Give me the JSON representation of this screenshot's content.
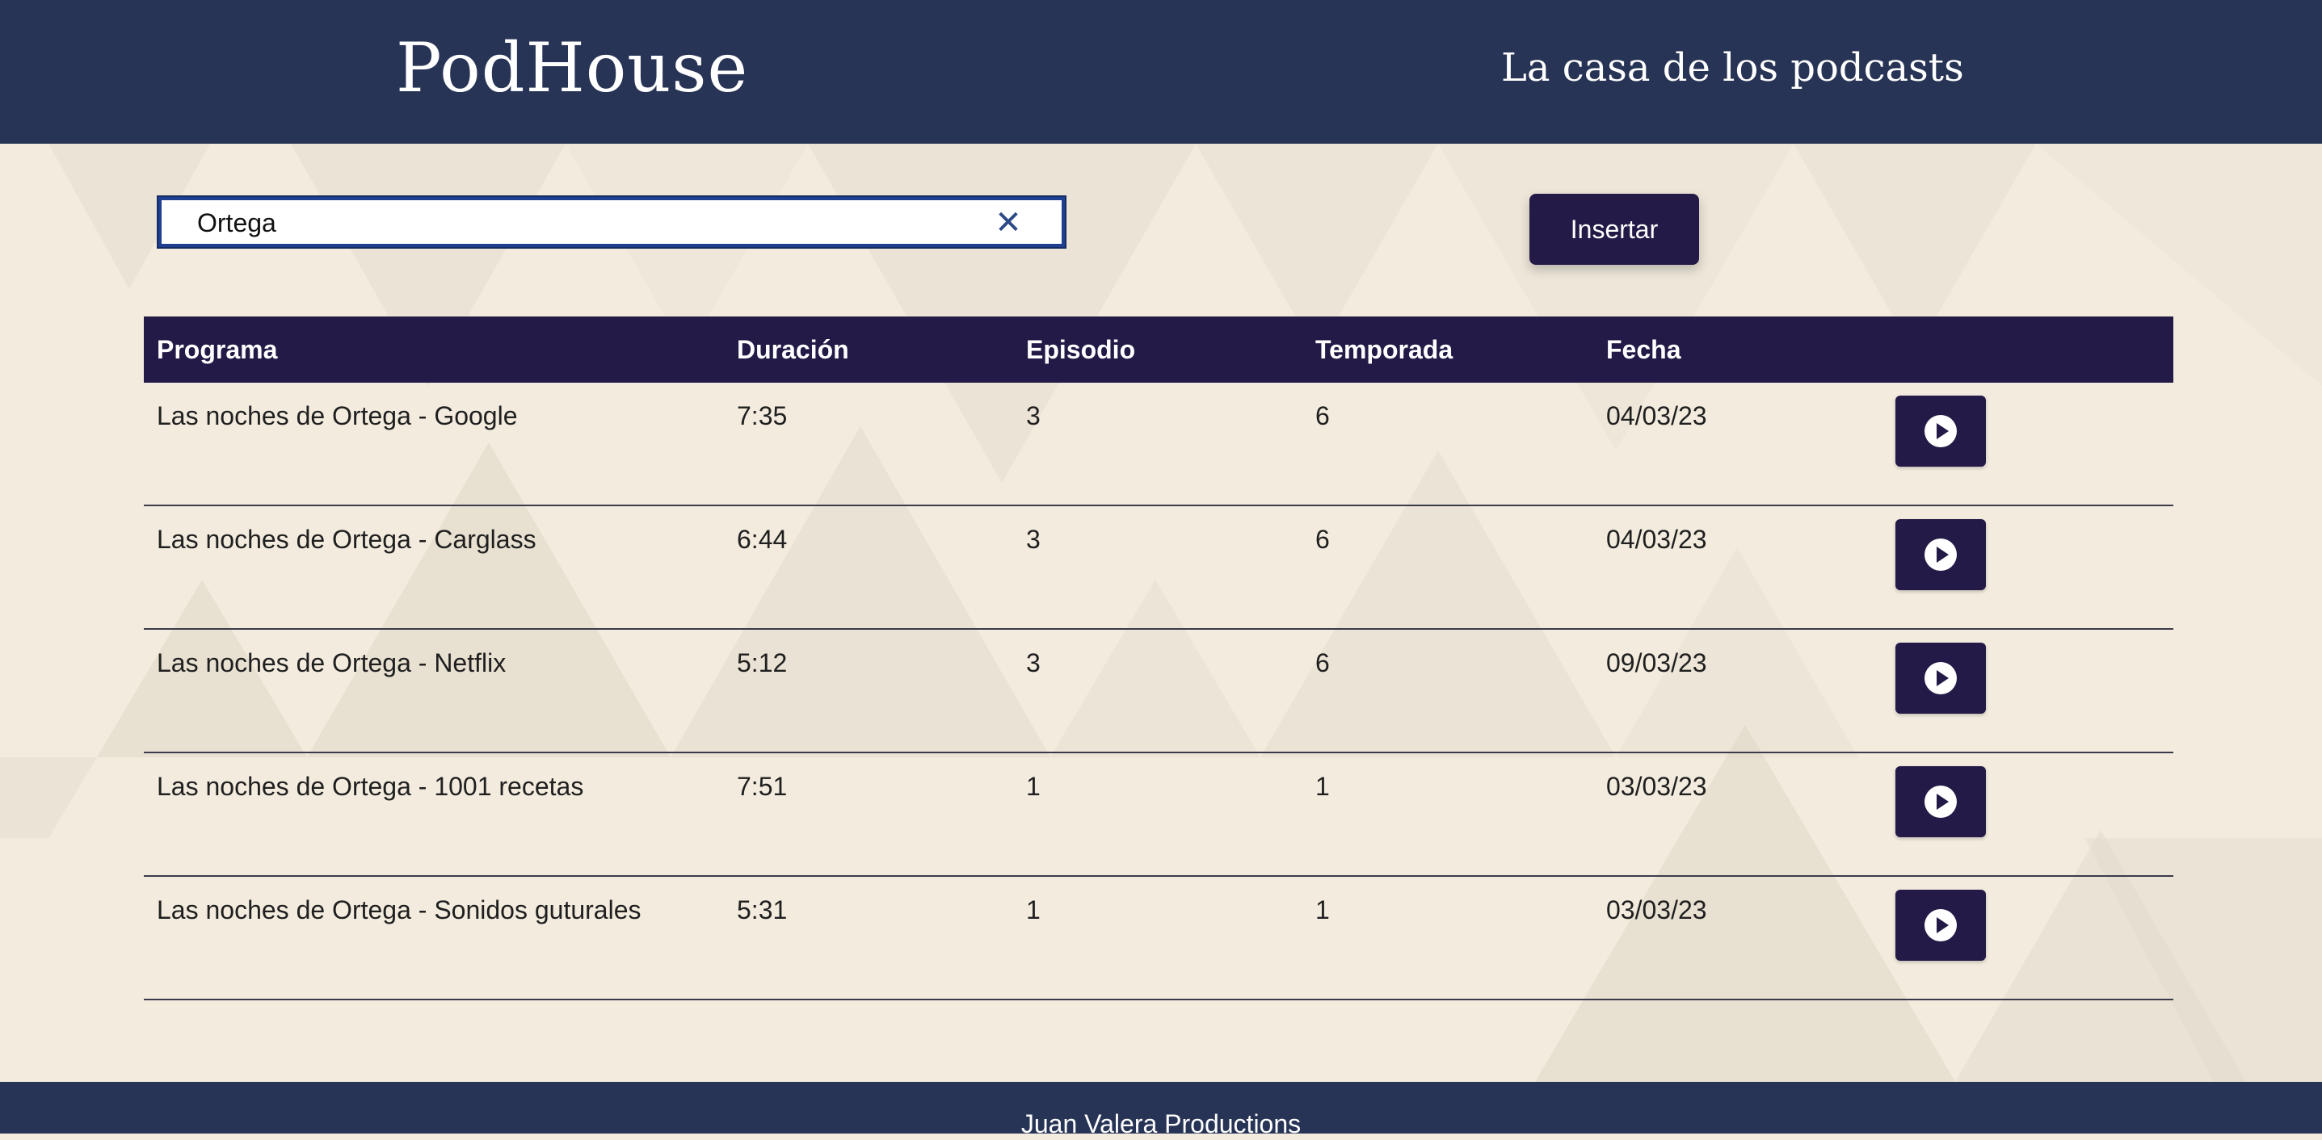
{
  "header": {
    "brand": "PodHouse",
    "tagline": "La casa de los podcasts"
  },
  "search": {
    "value": "Ortega",
    "clear_icon": "close-icon"
  },
  "actions": {
    "insert_label": "Insertar"
  },
  "table": {
    "columns": [
      "Programa",
      "Duración",
      "Episodio",
      "Temporada",
      "Fecha"
    ],
    "rows": [
      {
        "programa": "Las noches de Ortega - Google",
        "duracion": "7:35",
        "episodio": "3",
        "temporada": "6",
        "fecha": "04/03/23"
      },
      {
        "programa": "Las noches de Ortega - Carglass",
        "duracion": "6:44",
        "episodio": "3",
        "temporada": "6",
        "fecha": "04/03/23"
      },
      {
        "programa": "Las noches de Ortega - Netflix",
        "duracion": "5:12",
        "episodio": "3",
        "temporada": "6",
        "fecha": "09/03/23"
      },
      {
        "programa": "Las noches de Ortega - 1001 recetas",
        "duracion": "7:51",
        "episodio": "1",
        "temporada": "1",
        "fecha": "03/03/23"
      },
      {
        "programa": "Las noches de Ortega - Sonidos guturales",
        "duracion": "5:31",
        "episodio": "1",
        "temporada": "1",
        "fecha": "03/03/23"
      }
    ],
    "row_action_icon": "play-icon"
  },
  "footer": {
    "text": "Juan Valera Productions"
  },
  "colors": {
    "header_bg": "#283456",
    "table_header_bg": "#231a47",
    "page_bg": "#f2ebde"
  }
}
